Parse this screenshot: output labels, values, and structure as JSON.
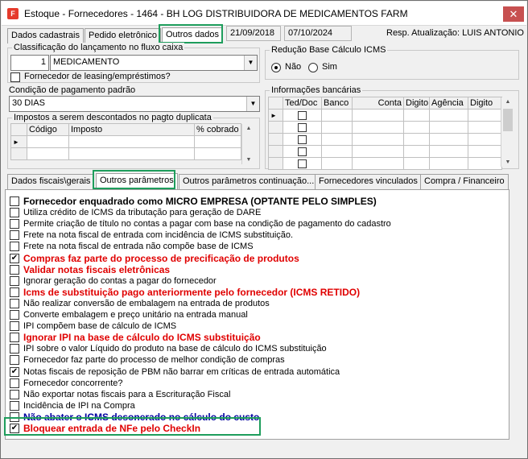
{
  "window": {
    "title": "Estoque - Fornecedores - 1464 - BH LOG DISTRIBUIDORA DE MEDICAMENTOS FARM",
    "app_icon_glyph": "F",
    "close_glyph": "✕"
  },
  "top_tabs": [
    "Dados cadastrais",
    "Pedido eletrônico",
    "Outros dados"
  ],
  "header_fields": {
    "date1": "21/09/2018",
    "date2": "07/10/2024",
    "resp": "Resp. Atualização: LUIS ANTONIO"
  },
  "classificacao": {
    "label": "Classificação do lançamento no fluxo caixa",
    "code": "1",
    "value": "MEDICAMENTO",
    "leasing_label": "Fornecedor de leasing/empréstimos?",
    "leasing_checked": false
  },
  "reducao": {
    "label": "Redução Base Cálculo ICMS",
    "options": [
      "Não",
      "Sim"
    ],
    "selected": "Não"
  },
  "condicao": {
    "label": "Condição de pagamento padrão",
    "value": "30 DIAS"
  },
  "impostos": {
    "label": "Impostos a serem descontados no pagto duplicata",
    "columns": [
      "Código",
      "Imposto",
      "% cobrado"
    ]
  },
  "bancarias": {
    "label": "Informações bancárias",
    "columns": [
      "Ted/Doc",
      "Banco",
      "Conta",
      "Digito",
      "Agência",
      "Digito"
    ]
  },
  "sub_tabs": [
    "Dados fiscais\\gerais",
    "Outros parâmetros",
    "Outros parâmetros continuação...",
    "Fornecedores vinculados",
    "Compra / Financeiro"
  ],
  "options": [
    {
      "label": "Fornecedor enquadrado como MICRO EMPRESA (OPTANTE PELO SIMPLES)",
      "checked": false,
      "style": "bold"
    },
    {
      "label": "Utiliza crédito de ICMS da tributação para geração de DARE",
      "checked": false,
      "style": "normal"
    },
    {
      "label": "Permite criação de título no contas a pagar com base na condição de pagamento do cadastro",
      "checked": false,
      "style": "normal"
    },
    {
      "label": "Frete na nota fiscal de entrada com incidência de ICMS substituição.",
      "checked": false,
      "style": "normal"
    },
    {
      "label": "Frete na nota fiscal de entrada não compõe base de ICMS",
      "checked": false,
      "style": "normal"
    },
    {
      "label": "Compras faz parte do processo de precificação de produtos",
      "checked": true,
      "style": "red"
    },
    {
      "label": "Validar notas fiscais eletrônicas",
      "checked": false,
      "style": "red"
    },
    {
      "label": "Ignorar geração do contas a pagar do fornecedor",
      "checked": false,
      "style": "normal"
    },
    {
      "label": "Icms de substituição pago anteriormente pelo fornecedor (ICMS RETIDO)",
      "checked": false,
      "style": "red"
    },
    {
      "label": "Não realizar conversão de embalagem na entrada de produtos",
      "checked": false,
      "style": "normal"
    },
    {
      "label": "Converte embalagem e preço unitário na entrada manual",
      "checked": false,
      "style": "normal"
    },
    {
      "label": "IPI compõem base de cálculo de ICMS",
      "checked": false,
      "style": "normal"
    },
    {
      "label": "Ignorar IPI na base de cálculo do ICMS substituição",
      "checked": false,
      "style": "red"
    },
    {
      "label": "IPI sobre o valor Líquido do produto na base de cálculo do ICMS substituição",
      "checked": false,
      "style": "normal"
    },
    {
      "label": "Fornecedor faz parte do processo de melhor condição de compras",
      "checked": false,
      "style": "normal"
    },
    {
      "label": "Notas fiscais de reposição de PBM não barrar em críticas de entrada automática",
      "checked": true,
      "style": "normal"
    },
    {
      "label": "Fornecedor concorrente?",
      "checked": false,
      "style": "normal"
    },
    {
      "label": "Não exportar notas fiscais para a Escrituração Fiscal",
      "checked": false,
      "style": "normal"
    },
    {
      "label": "Incidência de IPI na Compra",
      "checked": false,
      "style": "normal"
    },
    {
      "label": "Não abater o ICMS desonerado no cálculo do custo",
      "checked": false,
      "style": "blue"
    },
    {
      "label": "Bloquear entrada de NFe pelo CheckIn",
      "checked": true,
      "style": "red"
    }
  ],
  "colors": {
    "highlight": "#1e9d5c",
    "red_text": "#e00000",
    "blue_text": "#0000a0",
    "close": "#c75050"
  }
}
